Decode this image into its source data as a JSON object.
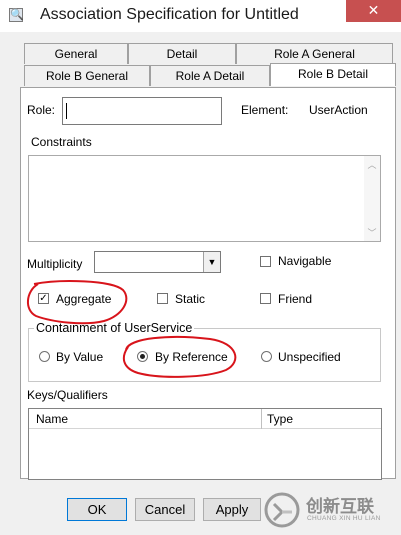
{
  "window": {
    "title": "Association Specification for Untitled",
    "close_glyph": "✕",
    "icon": "magnifier-icon",
    "icon_glyph": "🔍"
  },
  "tabs": [
    {
      "label": "General"
    },
    {
      "label": "Detail"
    },
    {
      "label": "Role A General"
    },
    {
      "label": "Role B General"
    },
    {
      "label": "Role A Detail"
    },
    {
      "label": "Role B Detail",
      "active": true
    }
  ],
  "form": {
    "role_label": "Role:",
    "role_value": "",
    "element_label": "Element:",
    "element_value": "UserAction",
    "constraints_label": "Constraints",
    "multiplicity_label": "Multiplicity",
    "multiplicity_value": "",
    "checkboxes": {
      "navigable": {
        "label": "Navigable",
        "checked": false
      },
      "aggregate": {
        "label": "Aggregate",
        "checked": true,
        "check_glyph": "✓"
      },
      "static": {
        "label": "Static",
        "checked": false
      },
      "friend": {
        "label": "Friend",
        "checked": false
      }
    },
    "containment": {
      "title": "Containment of UserService",
      "options": [
        {
          "label": "By Value",
          "selected": false
        },
        {
          "label": "By Reference",
          "selected": true
        },
        {
          "label": "Unspecified",
          "selected": false
        }
      ]
    },
    "keys": {
      "title": "Keys/Qualifiers",
      "columns": [
        "Name",
        "Type"
      ],
      "rows": []
    }
  },
  "buttons": {
    "ok": "OK",
    "cancel": "Cancel",
    "apply": "Apply"
  },
  "watermark": {
    "logo": "chuangxin-hulian-logo",
    "text_cn": "创新互联",
    "text_en": "CHUANG XIN HU LIAN"
  },
  "colors": {
    "annotation_red": "#d8141b",
    "close_red": "#c75050",
    "focus_blue": "#0078d7"
  }
}
